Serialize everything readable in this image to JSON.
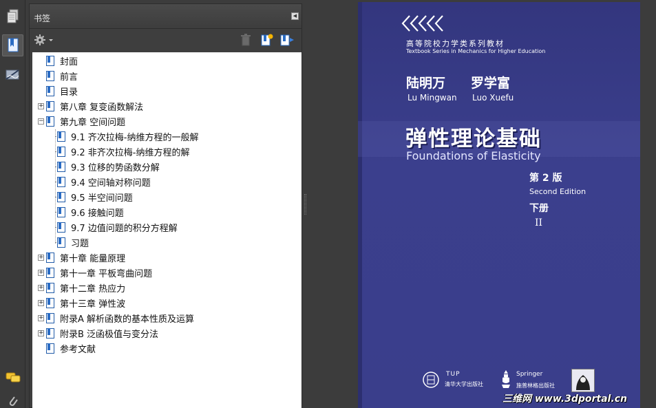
{
  "panel": {
    "title": "书签"
  },
  "bookmarks": [
    {
      "label": "封面"
    },
    {
      "label": "前言"
    },
    {
      "label": "目录"
    },
    {
      "label": "第八章  复变函数解法",
      "toggle": "+"
    },
    {
      "label": "第九章  空间问题",
      "toggle": "−"
    },
    {
      "label": "9.1  齐次拉梅-纳维方程的一般解"
    },
    {
      "label": "9.2  非齐次拉梅-纳维方程的解"
    },
    {
      "label": "9.3  位移的势函数分解"
    },
    {
      "label": "9.4  空间轴对称问题"
    },
    {
      "label": "9.5  半空间问题"
    },
    {
      "label": "9.6  接触问题"
    },
    {
      "label": "9.7  边值问题的积分方程解"
    },
    {
      "label": "习题"
    },
    {
      "label": "第十章  能量原理",
      "toggle": "+"
    },
    {
      "label": "第十一章  平板弯曲问题",
      "toggle": "+"
    },
    {
      "label": "第十二章  热应力",
      "toggle": "+"
    },
    {
      "label": "第十三章  弹性波",
      "toggle": "+"
    },
    {
      "label": "附录A  解析函数的基本性质及运算",
      "toggle": "+"
    },
    {
      "label": "附录B  泛函极值与变分法",
      "toggle": "+"
    },
    {
      "label": "参考文献"
    }
  ],
  "cover": {
    "series_cn": "高等院校力学类系列教材",
    "series_en": "Textbook Series in Mechanics for Higher Education",
    "author1_cn": "陆明万",
    "author2_cn": "罗学富",
    "author1_en": "Lu Mingwan",
    "author2_en": "Luo Xuefu",
    "title_cn": "弹性理论基础",
    "title_en": "Foundations of Elasticity",
    "edition_cn": "第 2 版",
    "edition_en": "Second Edition",
    "volume_cn": "下册",
    "volume_num": "II",
    "publisher1_en": "TUP",
    "publisher1_cn": "清华大学出版社",
    "publisher2_en": "Springer",
    "publisher2_cn": "施普林格出版社"
  },
  "watermark": "三维网 www.3dportal.cn",
  "colors": {
    "cover_blue": "#383b86",
    "bookmark_icon": "#2b6cc4",
    "panel_bg": "#3e3e3e"
  },
  "icons": {
    "rail": [
      "pages-icon",
      "bookmarks-icon",
      "signatures-icon",
      "comments-icon",
      "attachments-icon"
    ],
    "toolbar": [
      "options-gear-icon",
      "delete-bookmark-icon",
      "new-bookmark-icon",
      "expand-bookmark-icon"
    ]
  }
}
